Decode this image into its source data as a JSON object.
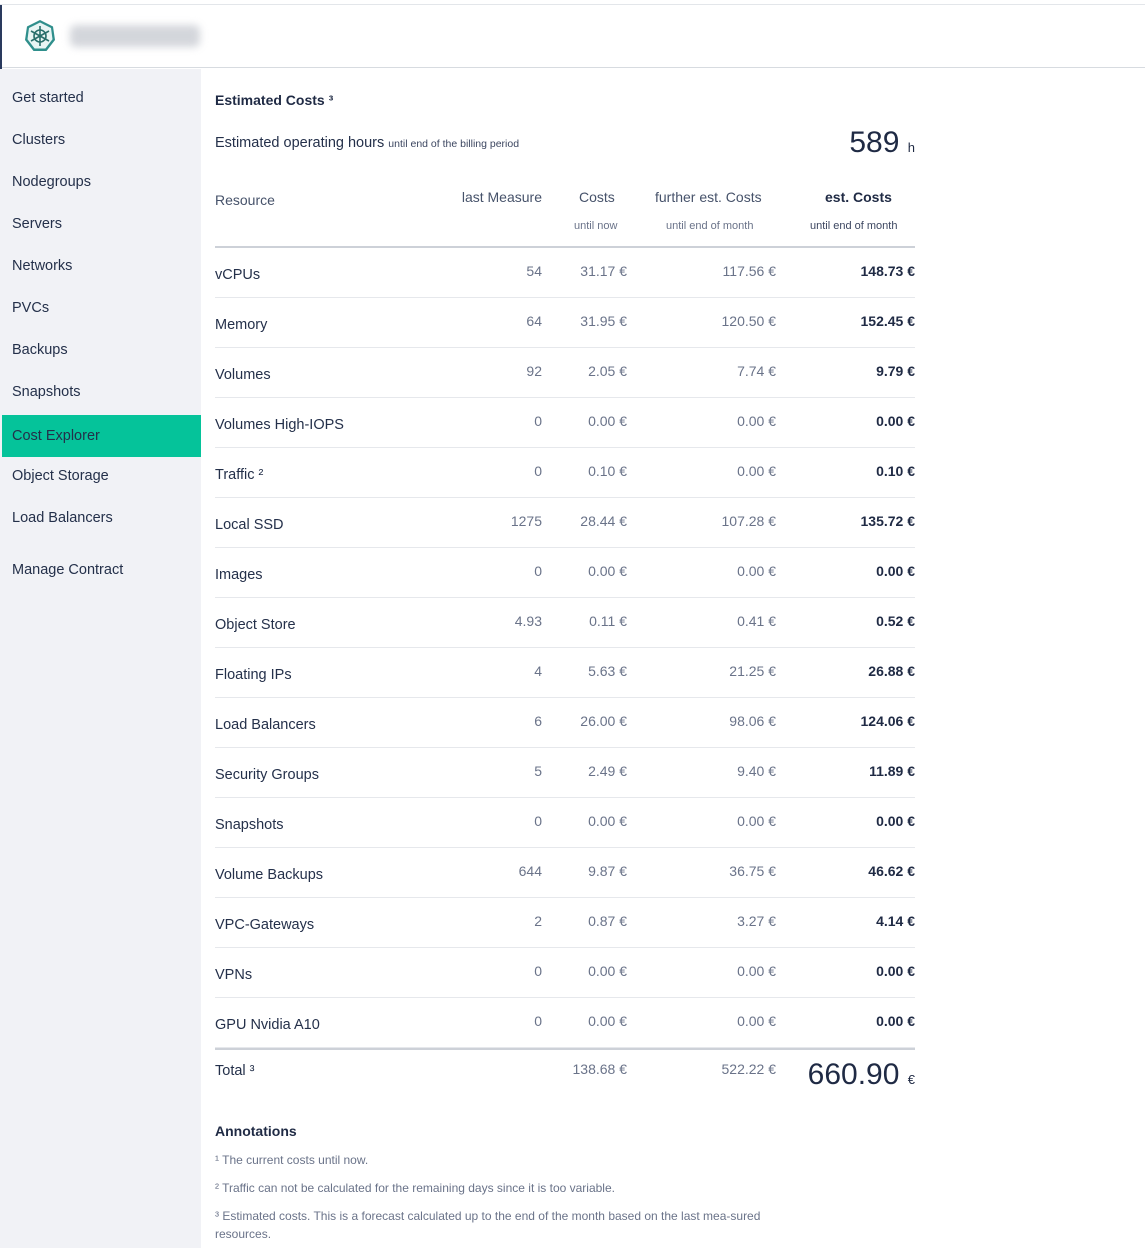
{
  "header": {
    "project_name": ""
  },
  "sidebar": {
    "items": [
      {
        "label": "Get started"
      },
      {
        "label": "Clusters"
      },
      {
        "label": "Nodegroups"
      },
      {
        "label": "Servers"
      },
      {
        "label": "Networks"
      },
      {
        "label": "PVCs"
      },
      {
        "label": "Backups"
      },
      {
        "label": "Snapshots"
      },
      {
        "label": "Cost Explorer",
        "active": true
      },
      {
        "label": "Object Storage"
      },
      {
        "label": "Load Balancers"
      },
      {
        "label": "Manage Contract"
      }
    ],
    "active_color": "#05c39a"
  },
  "costs": {
    "title": "Estimated Costs ³",
    "hours_label": "Estimated operating hours",
    "hours_sub": "until end of the billing period",
    "hours_value": "589",
    "hours_unit": "h",
    "columns": {
      "resource": "Resource",
      "measure": "last Measure",
      "costs": "Costs",
      "costs_sub": "until now",
      "further": "further est. Costs",
      "further_sub": "until end of month",
      "est": "est. Costs",
      "est_sub": "until end of month"
    },
    "rows": [
      {
        "name": "vCPUs",
        "measure": "54",
        "costs": "31.17 €",
        "further": "117.56 €",
        "est": "148.73 €"
      },
      {
        "name": "Memory",
        "measure": "64",
        "costs": "31.95 €",
        "further": "120.50 €",
        "est": "152.45 €"
      },
      {
        "name": "Volumes",
        "measure": "92",
        "costs": "2.05 €",
        "further": "7.74 €",
        "est": "9.79 €"
      },
      {
        "name": "Volumes High-IOPS",
        "measure": "0",
        "costs": "0.00 €",
        "further": "0.00 €",
        "est": "0.00 €"
      },
      {
        "name": "Traffic ²",
        "measure": "0",
        "costs": "0.10 €",
        "further": "0.00 €",
        "est": "0.10 €"
      },
      {
        "name": "Local SSD",
        "measure": "1275",
        "costs": "28.44 €",
        "further": "107.28 €",
        "est": "135.72 €"
      },
      {
        "name": "Images",
        "measure": "0",
        "costs": "0.00 €",
        "further": "0.00 €",
        "est": "0.00 €"
      },
      {
        "name": "Object Store",
        "measure": "4.93",
        "costs": "0.11 €",
        "further": "0.41 €",
        "est": "0.52 €"
      },
      {
        "name": "Floating IPs",
        "measure": "4",
        "costs": "5.63 €",
        "further": "21.25 €",
        "est": "26.88 €"
      },
      {
        "name": "Load Balancers",
        "measure": "6",
        "costs": "26.00 €",
        "further": "98.06 €",
        "est": "124.06 €"
      },
      {
        "name": "Security Groups",
        "measure": "5",
        "costs": "2.49 €",
        "further": "9.40 €",
        "est": "11.89 €"
      },
      {
        "name": "Snapshots",
        "measure": "0",
        "costs": "0.00 €",
        "further": "0.00 €",
        "est": "0.00 €"
      },
      {
        "name": "Volume Backups",
        "measure": "644",
        "costs": "9.87 €",
        "further": "36.75 €",
        "est": "46.62 €"
      },
      {
        "name": "VPC-Gateways",
        "measure": "2",
        "costs": "0.87 €",
        "further": "3.27 €",
        "est": "4.14 €"
      },
      {
        "name": "VPNs",
        "measure": "0",
        "costs": "0.00 €",
        "further": "0.00 €",
        "est": "0.00 €"
      },
      {
        "name": "GPU Nvidia A10",
        "measure": "0",
        "costs": "0.00 €",
        "further": "0.00 €",
        "est": "0.00 €"
      }
    ],
    "total": {
      "label": "Total ³",
      "costs": "138.68 €",
      "further": "522.22 €",
      "value": "660.90",
      "unit": "€"
    }
  },
  "annotations": {
    "title": "Annotations",
    "items": [
      "¹ The current costs until now.",
      "² Traffic can not be calculated for the remaining days since it is too variable.",
      "³ Estimated costs. This is a forecast calculated up to the end of the month based on the last mea-sured resources."
    ]
  }
}
